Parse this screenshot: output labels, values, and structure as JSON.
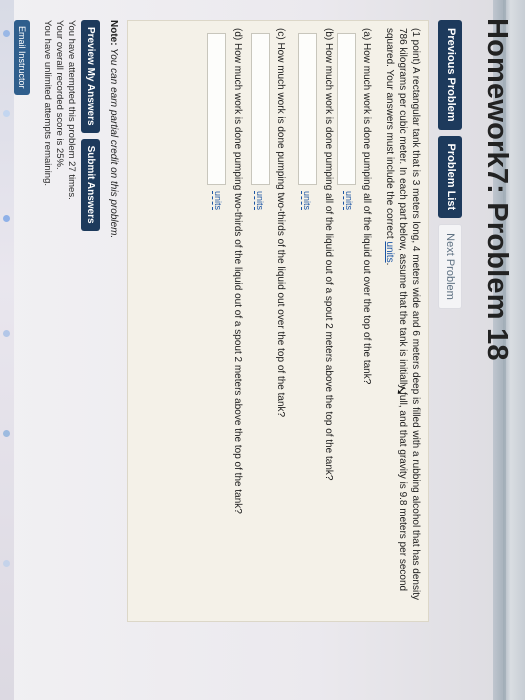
{
  "page": {
    "title": "Homework7: Problem 18",
    "nav": {
      "previous": "Previous Problem",
      "list": "Problem List",
      "next": "Next Problem"
    },
    "problem": {
      "intro_a": "(1 point) A rectangular tank that is 3 meters long, 4 meters wide and 6 meters deep is filled with a rubbing alcohol that has density 786 kilograms per cubic meter. In each part below, assume that the tank is initially full, and that gravity is 9.8 meters per second squared. Your answers must include the correct ",
      "intro_link": "units",
      "intro_end": ".",
      "questions": [
        {
          "label": "(a) How much work is done pumping all of the liquid out over the top of the tank?",
          "units": "units"
        },
        {
          "label": "(b) How much work is done pumping all of the liquid out of a spout 2 meters above the top of the tank?",
          "units": "units"
        },
        {
          "label": "(c) How much work is done pumping two-thirds of the liquid out over the top of the tank?",
          "units": "units"
        },
        {
          "label": "(d) How much work is done pumping two-thirds of the liquid out of a spout 2 meters above the top of the tank?",
          "units": "units"
        }
      ]
    },
    "note_label": "Note:",
    "note_text": " You can earn partial credit on this problem.",
    "actions": {
      "preview": "Preview My Answers",
      "submit": "Submit Answers"
    },
    "status": {
      "attempts": "You have attempted this problem 27 times.",
      "score": "Your overall recorded score is 25%.",
      "remaining": "You have unlimited attempts remaining."
    },
    "email_button": "Email Instructor"
  },
  "colors": {
    "nav_button": "#1d3a5c",
    "problem_bg": "#f4f1e8",
    "link": "#1b55a4"
  }
}
